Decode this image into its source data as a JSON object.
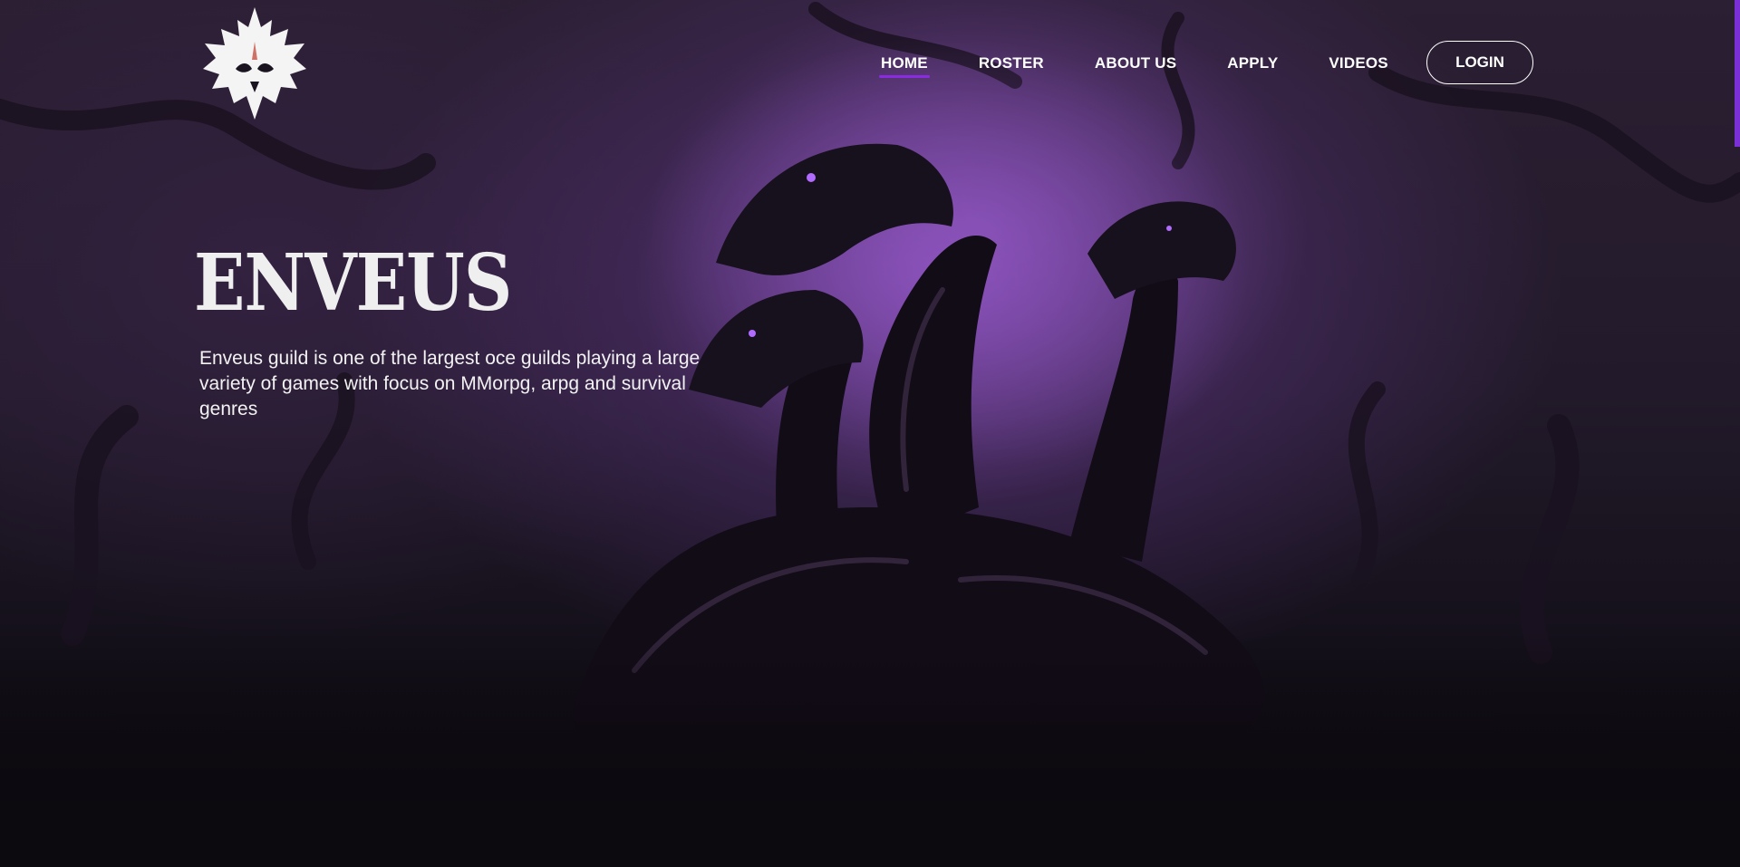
{
  "brand": {
    "logo_icon": "hydra-skull-logo",
    "accent_color": "#8a2be2"
  },
  "nav": {
    "items": [
      {
        "label": "HOME",
        "active": true
      },
      {
        "label": "ROSTER",
        "active": false
      },
      {
        "label": "ABOUT US",
        "active": false
      },
      {
        "label": "APPLY",
        "active": false
      },
      {
        "label": "VIDEOS",
        "active": false
      }
    ],
    "login_label": "LOGIN"
  },
  "hero": {
    "title": "ENVEUS",
    "description": "Enveus guild is one of the largest oce guilds playing a large variety of games with focus on MMorpg, arpg and survival genres",
    "background": "purple multi-headed hydra artwork"
  }
}
